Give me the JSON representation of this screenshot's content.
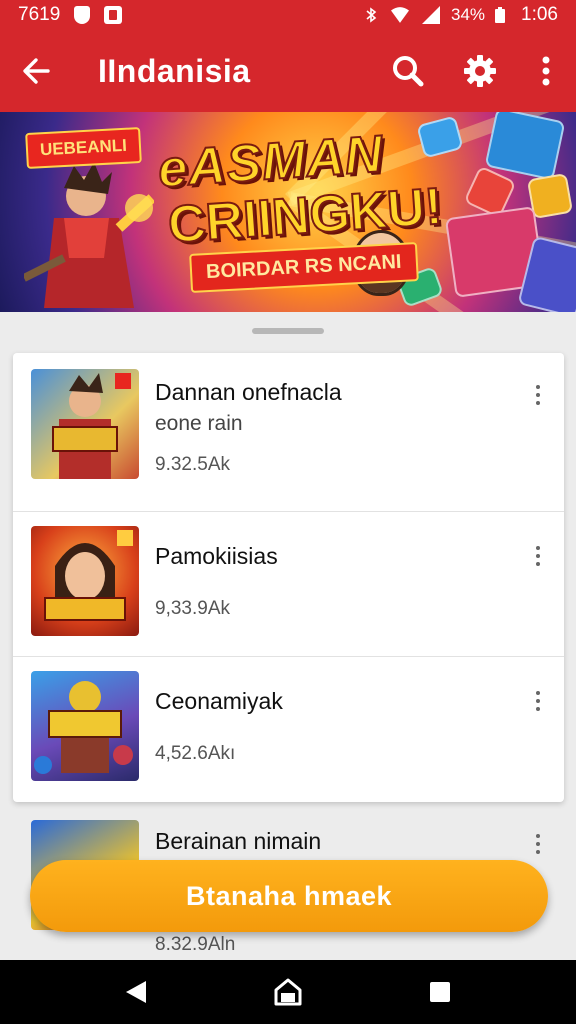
{
  "status_bar": {
    "left_text": "7619",
    "battery_text": "34%",
    "time": "1:06",
    "icons": [
      "shield-icon",
      "notification-icon",
      "bluetooth-icon",
      "wifi-icon",
      "signal-icon",
      "battery-icon"
    ]
  },
  "app_bar": {
    "title": "IIndanisia",
    "back_icon": "arrow-left-icon",
    "actions": [
      "search-icon",
      "settings-icon",
      "more-vert-icon"
    ]
  },
  "banner": {
    "tag": "UEBEANLI",
    "title_line1": "eASMAN",
    "title_line2": "CRIINGKU!",
    "subtitle": "BOIRDAR RS NCANI"
  },
  "games": [
    {
      "name": "Dannan onefnacla",
      "subtitle": "eone rain",
      "size": "9.32.5Ak"
    },
    {
      "name": "Pamokiisias",
      "subtitle": "",
      "size": "9,33.9Ak"
    },
    {
      "name": "Ceonamiyak",
      "subtitle": "",
      "size": "4,52.6Akı"
    },
    {
      "name": "Berainan nimain",
      "subtitle": "",
      "size": "8.32.9Aln"
    }
  ],
  "fab": {
    "label": "Btanaha hmaek"
  },
  "colors": {
    "brand": "#d5272c",
    "fab": "#f5a012"
  }
}
